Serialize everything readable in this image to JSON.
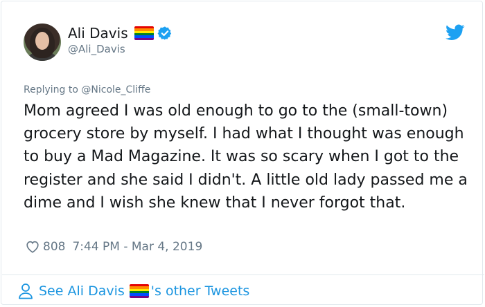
{
  "author": {
    "display_name": "Ali Davis",
    "handle": "@Ali_Davis",
    "flag_colors": [
      "#e40303",
      "#ff8c00",
      "#ffed00",
      "#008026",
      "#004dff",
      "#750787"
    ],
    "verified_color": "#1da1f2"
  },
  "tweet": {
    "replying_prefix": "Replying to ",
    "replying_to": "@Nicole_Cliffe",
    "text": "Mom agreed I was old enough to go to the (small-town) grocery store by myself. I had what I thought was enough to buy a Mad Magazine. It was so scary when I got to the register and she said I didn't. A little old lady passed me a dime and I wish she knew that I never forgot that.",
    "likes": "808",
    "timestamp": "7:44 PM - Mar 4, 2019"
  },
  "footer": {
    "prefix": "See Ali Davis",
    "suffix": "'s other Tweets"
  },
  "colors": {
    "link": "#1b95e0",
    "muted": "#657786",
    "twitter_blue": "#1da1f2"
  },
  "icons": {
    "bird": "twitter-bird-icon",
    "heart": "heart-outline-icon",
    "person": "person-outline-icon",
    "verified": "verified-badge-icon"
  }
}
